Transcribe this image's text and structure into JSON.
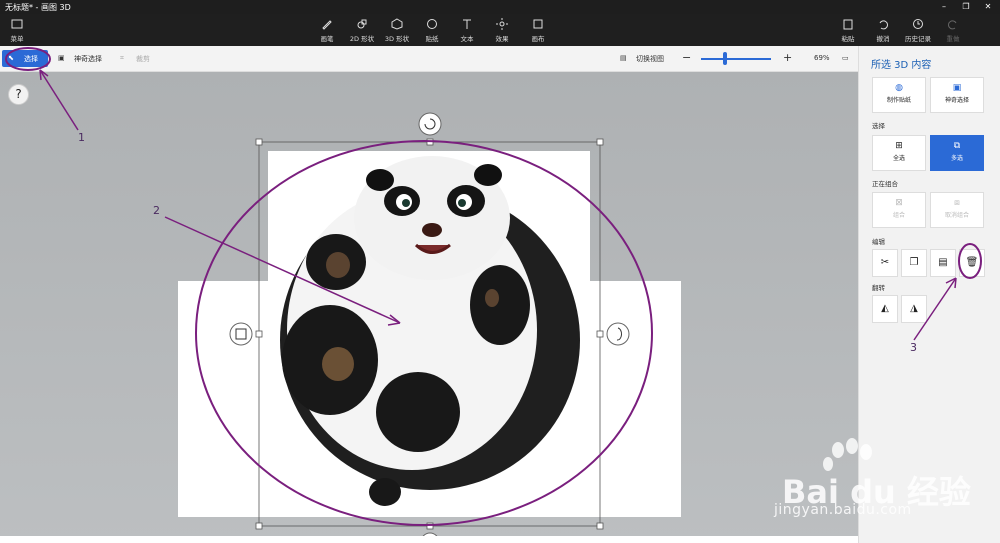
{
  "window": {
    "title": "无标题* - 画图 3D"
  },
  "ribbon": {
    "menu_label": "菜单",
    "tools": [
      {
        "label": "画笔",
        "icon": "brush-icon"
      },
      {
        "label": "2D 形状",
        "icon": "shapes-2d-icon"
      },
      {
        "label": "3D 形状",
        "icon": "shapes-3d-icon"
      },
      {
        "label": "贴纸",
        "icon": "sticker-icon"
      },
      {
        "label": "文本",
        "icon": "text-icon"
      },
      {
        "label": "效果",
        "icon": "effects-icon"
      },
      {
        "label": "画布",
        "icon": "canvas-icon"
      }
    ],
    "right": [
      {
        "label": "粘贴",
        "icon": "paste-icon"
      },
      {
        "label": "撤消",
        "icon": "undo-icon"
      },
      {
        "label": "历史记录",
        "icon": "history-icon"
      },
      {
        "label": "重做",
        "icon": "redo-icon"
      }
    ]
  },
  "toolbar": {
    "select_label": "选择",
    "magic_select_label": "神奇选择",
    "crop_label": "裁剪",
    "switch_view_label": "切换视图",
    "zoom_minus": "−",
    "zoom_plus": "+",
    "zoom_value": "69%"
  },
  "help": {
    "label": "?"
  },
  "panel": {
    "title": "所选 3D 内容",
    "make_sticker": "制作贴纸",
    "magic_select": "神奇选择",
    "select_section": "选择",
    "select_all": "全选",
    "multi_select": "多选",
    "group_section": "正在组合",
    "group": "组合",
    "ungroup": "取消组合",
    "edit_section": "编辑",
    "flip_section": "翻转"
  },
  "annotations": {
    "a1": "1",
    "a2": "2",
    "a3": "3"
  },
  "watermark": {
    "brand": "Bai du 经验",
    "url": "jingyan.baidu.com"
  },
  "colors": {
    "accent": "#2b6ad6",
    "annotation": "#7a1f7e"
  }
}
